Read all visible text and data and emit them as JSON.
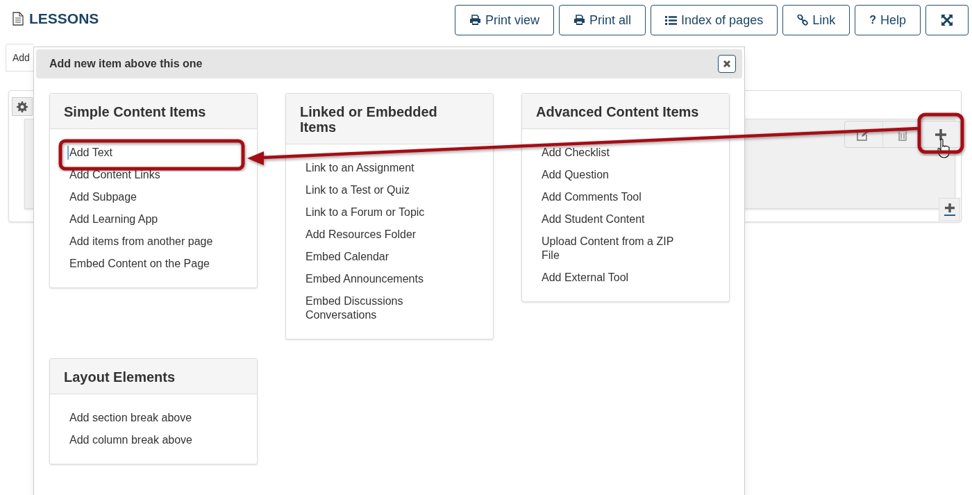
{
  "page": {
    "title": "LESSONS"
  },
  "toolbar": [
    {
      "kind": "print",
      "label": "Print view"
    },
    {
      "kind": "print",
      "label": "Print all"
    },
    {
      "kind": "list",
      "label": "Index of pages"
    },
    {
      "kind": "link",
      "label": "Link"
    },
    {
      "kind": "help",
      "icon": "?",
      "label": "Help"
    },
    {
      "kind": "fullscreen"
    }
  ],
  "tabs": [
    {
      "label": "Add"
    }
  ],
  "dialog": {
    "title": "Add new item above this one",
    "sections": [
      {
        "title": "Simple Content Items",
        "items": [
          {
            "label": "Add Text",
            "focused": true
          },
          {
            "label": "Add Content Links",
            "focused": false
          },
          {
            "label": "Add Subpage",
            "focused": false
          },
          {
            "label": "Add Learning App",
            "focused": false
          },
          {
            "label": "Add items from another page",
            "focused": false
          },
          {
            "label": "Embed Content on the Page",
            "focused": false
          }
        ]
      },
      {
        "title": "Linked or Embedded Items",
        "items": [
          {
            "label": "Link to an Assignment",
            "focused": false
          },
          {
            "label": "Link to a Test or Quiz",
            "focused": false
          },
          {
            "label": "Link to a Forum or Topic",
            "focused": false
          },
          {
            "label": "Add Resources Folder",
            "focused": false
          },
          {
            "label": "Embed Calendar",
            "focused": false
          },
          {
            "label": "Embed Announcements",
            "focused": false
          },
          {
            "label": "Embed Discussions Conversations",
            "focused": false
          }
        ]
      },
      {
        "title": "Advanced Content Items",
        "items": [
          {
            "label": "Add Checklist",
            "focused": false
          },
          {
            "label": "Add Question",
            "focused": false
          },
          {
            "label": "Add Comments Tool",
            "focused": false
          },
          {
            "label": "Add Student Content",
            "focused": false
          },
          {
            "label": "Upload Content from a ZIP File",
            "focused": false
          },
          {
            "label": "Add External Tool",
            "focused": false
          }
        ]
      },
      {
        "title": "Layout Elements",
        "items": [
          {
            "label": "Add section break above",
            "focused": false
          },
          {
            "label": "Add column break above",
            "focused": false
          }
        ]
      }
    ]
  }
}
